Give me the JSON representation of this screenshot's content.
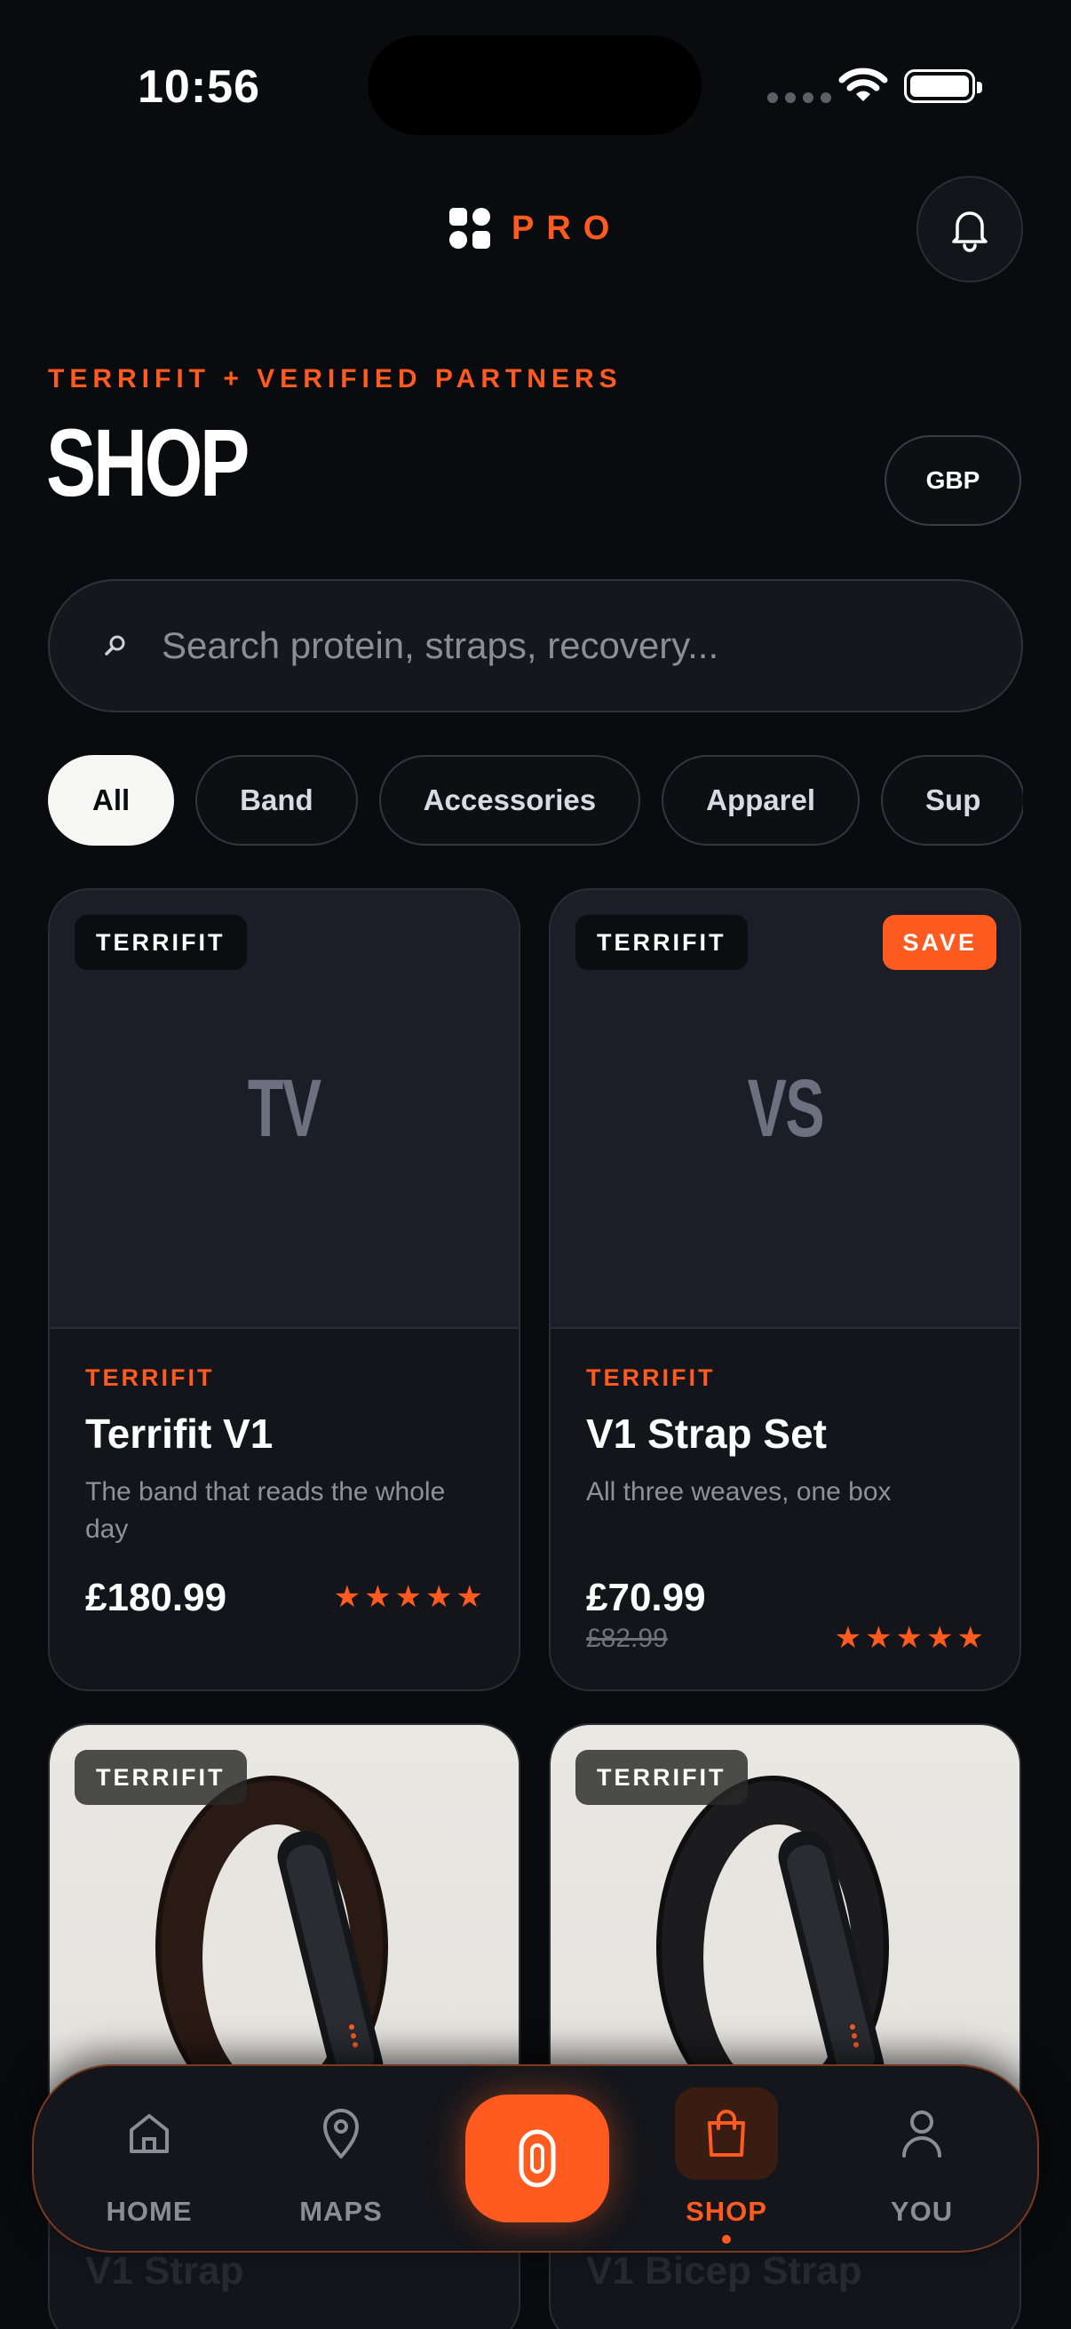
{
  "status_bar": {
    "time": "10:56"
  },
  "header": {
    "logo_text": "PRO"
  },
  "shop": {
    "eyebrow": "TERRIFIT + VERIFIED PARTNERS",
    "title": "SHOP",
    "currency": "GBP"
  },
  "search": {
    "placeholder": "Search protein, straps, recovery..."
  },
  "categories": [
    {
      "label": "All",
      "active": true
    },
    {
      "label": "Band",
      "active": false
    },
    {
      "label": "Accessories",
      "active": false
    },
    {
      "label": "Apparel",
      "active": false
    },
    {
      "label": "Sup",
      "active": false
    }
  ],
  "products": [
    {
      "tag": "TERRIFIT",
      "initials": "TV",
      "brand": "TERRIFIT",
      "name": "Terrifit V1",
      "description": "The band that reads the whole day",
      "price": "£180.99",
      "rating": 5
    },
    {
      "tag": "TERRIFIT",
      "badge": "SAVE",
      "initials": "VS",
      "brand": "TERRIFIT",
      "name": "V1 Strap Set",
      "description": "All three weaves, one box",
      "price": "£70.99",
      "old_price": "£82.99",
      "rating": 5
    },
    {
      "tag": "TERRIFIT",
      "name": "V1 Strap"
    },
    {
      "tag": "TERRIFIT",
      "name": "V1 Bicep Strap"
    }
  ],
  "tabbar": {
    "tabs": [
      {
        "label": "HOME",
        "icon": "home-icon"
      },
      {
        "label": "MAPS",
        "icon": "map-pin-icon"
      },
      {
        "label": "SHOP",
        "icon": "shopping-bag-icon",
        "active": true
      },
      {
        "label": "YOU",
        "icon": "user-icon"
      }
    ],
    "center_icon": "band-icon"
  },
  "colors": {
    "accent": "#ff5a1f",
    "background": "#0a0b0e",
    "card": "#13151b"
  }
}
